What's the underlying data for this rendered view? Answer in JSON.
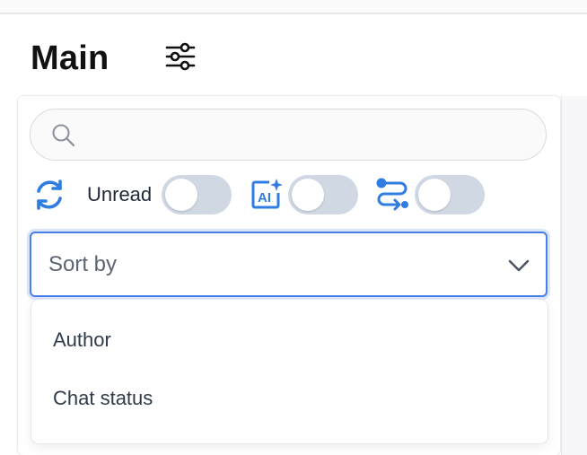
{
  "header": {
    "title": "Main",
    "filter_icon": "sliders-icon"
  },
  "search": {
    "placeholder": "",
    "value": "",
    "icon": "search-icon"
  },
  "quick_filters": {
    "refresh_icon": "refresh-icon",
    "unread_label": "Unread",
    "unread_on": false,
    "ai_icon": "ai-sparkle-icon",
    "ai_on": false,
    "routing_icon": "routing-icon",
    "routing_on": false
  },
  "sort": {
    "placeholder": "Sort by",
    "options": [
      "Author",
      "Chat status"
    ]
  },
  "colors": {
    "accent": "#2f7de1",
    "focus_border": "#4a7fe8",
    "toggle_off": "#cfd8e3"
  }
}
